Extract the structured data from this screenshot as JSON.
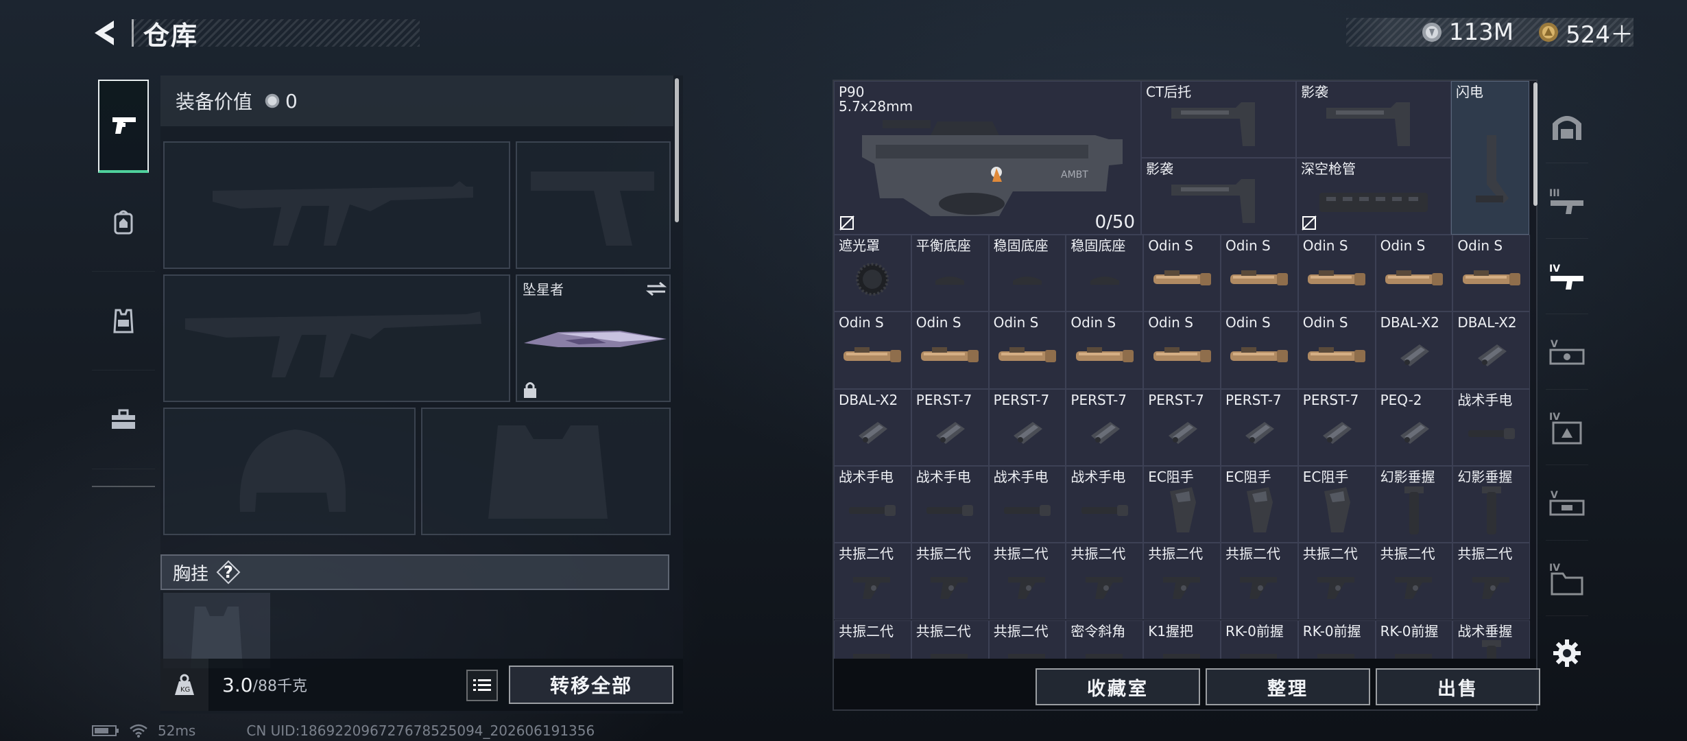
{
  "header": {
    "title": "仓库",
    "back_icon": "back-arrow-icon"
  },
  "currencies": [
    {
      "icon": "silver-coin-icon",
      "value": "113M",
      "color": "#c9ccd2"
    },
    {
      "icon": "gold-coin-icon",
      "value": "524＋",
      "color": "#d8b46a"
    }
  ],
  "left_rail": [
    {
      "icon": "pistol-icon",
      "active": true
    },
    {
      "icon": "backpack-icon",
      "active": false
    },
    {
      "icon": "vest-icon",
      "active": false
    },
    {
      "icon": "toolbox-icon",
      "active": false
    }
  ],
  "loadout": {
    "equip_value_label": "装备价值",
    "equip_value": "0",
    "melee_name": "坠星者",
    "chest_label": "胸挂",
    "help_glyph": "?",
    "weight_value": "3.0",
    "weight_capacity": "/88千克",
    "transfer_all_label": "转移全部"
  },
  "storage": {
    "p90": {
      "name": "P90",
      "caliber": "5.7x28mm",
      "ammo": "0/50"
    },
    "top_items": [
      {
        "name": "CT后托",
        "kind": "stock"
      },
      {
        "name": "影袭",
        "kind": "stock"
      },
      {
        "name": "闪电",
        "kind": "stock-v"
      },
      {
        "name": "影袭",
        "kind": "stock"
      },
      {
        "name": "深空枪管",
        "kind": "handguard"
      }
    ],
    "rows": [
      [
        {
          "name": "遮光罩",
          "kind": "hood"
        },
        {
          "name": "平衡底座",
          "kind": "mount"
        },
        {
          "name": "稳固底座",
          "kind": "mount"
        },
        {
          "name": "稳固底座",
          "kind": "mount"
        },
        {
          "name": "Odin S",
          "kind": "light"
        },
        {
          "name": "Odin S",
          "kind": "light"
        },
        {
          "name": "Odin S",
          "kind": "light"
        },
        {
          "name": "Odin S",
          "kind": "light"
        },
        {
          "name": "Odin S",
          "kind": "light"
        }
      ],
      [
        {
          "name": "Odin S",
          "kind": "light"
        },
        {
          "name": "Odin S",
          "kind": "light"
        },
        {
          "name": "Odin S",
          "kind": "light"
        },
        {
          "name": "Odin S",
          "kind": "light"
        },
        {
          "name": "Odin S",
          "kind": "light"
        },
        {
          "name": "Odin S",
          "kind": "light"
        },
        {
          "name": "Odin S",
          "kind": "light"
        },
        {
          "name": "DBAL-X2",
          "kind": "laser"
        },
        {
          "name": "DBAL-X2",
          "kind": "laser"
        }
      ],
      [
        {
          "name": "DBAL-X2",
          "kind": "laser"
        },
        {
          "name": "PERST-7",
          "kind": "laser"
        },
        {
          "name": "PERST-7",
          "kind": "laser"
        },
        {
          "name": "PERST-7",
          "kind": "laser"
        },
        {
          "name": "PERST-7",
          "kind": "laser"
        },
        {
          "name": "PERST-7",
          "kind": "laser"
        },
        {
          "name": "PERST-7",
          "kind": "laser"
        },
        {
          "name": "PEQ-2",
          "kind": "laser"
        },
        {
          "name": "战术手电",
          "kind": "flashlight"
        }
      ],
      [
        {
          "name": "战术手电",
          "kind": "flashlight"
        },
        {
          "name": "战术手电",
          "kind": "flashlight"
        },
        {
          "name": "战术手电",
          "kind": "flashlight"
        },
        {
          "name": "战术手电",
          "kind": "flashlight"
        },
        {
          "name": "EC阻手",
          "kind": "ecgrip"
        },
        {
          "name": "EC阻手",
          "kind": "ecgrip"
        },
        {
          "name": "EC阻手",
          "kind": "ecgrip"
        },
        {
          "name": "幻影垂握",
          "kind": "vgrip"
        },
        {
          "name": "幻影垂握",
          "kind": "vgrip"
        }
      ],
      [
        {
          "name": "共振二代",
          "kind": "agrip"
        },
        {
          "name": "共振二代",
          "kind": "agrip"
        },
        {
          "name": "共振二代",
          "kind": "agrip"
        },
        {
          "name": "共振二代",
          "kind": "agrip"
        },
        {
          "name": "共振二代",
          "kind": "agrip"
        },
        {
          "name": "共振二代",
          "kind": "agrip"
        },
        {
          "name": "共振二代",
          "kind": "agrip"
        },
        {
          "name": "共振二代",
          "kind": "agrip"
        },
        {
          "name": "共振二代",
          "kind": "agrip"
        }
      ],
      [
        {
          "name": "共振二代",
          "kind": "agrip"
        },
        {
          "name": "共振二代",
          "kind": "agrip"
        },
        {
          "name": "共振二代",
          "kind": "agrip"
        },
        {
          "name": "密令斜角",
          "kind": "agrip"
        },
        {
          "name": "K1握把",
          "kind": "agrip"
        },
        {
          "name": "RK-0前握",
          "kind": "agrip"
        },
        {
          "name": "RK-0前握",
          "kind": "agrip"
        },
        {
          "name": "RK-0前握",
          "kind": "agrip"
        },
        {
          "name": "战术垂握",
          "kind": "vgrip"
        }
      ]
    ],
    "buttons": {
      "collection": "收藏室",
      "organize": "整理",
      "sell": "出售"
    }
  },
  "right_rail": [
    {
      "icon": "helmet-shelf-icon",
      "label": ""
    },
    {
      "icon": "weapon-tier-3-icon",
      "label": "III"
    },
    {
      "icon": "weapon-tier-4-icon",
      "label": "IV",
      "active": true
    },
    {
      "icon": "attachment-tier-5-icon",
      "label": "V"
    },
    {
      "icon": "armor-tier-4-icon",
      "label": "IV"
    },
    {
      "icon": "attachment-tier-5b-icon",
      "label": "V"
    },
    {
      "icon": "folder-tier-4-icon",
      "label": "IV"
    },
    {
      "icon": "settings-gear-icon",
      "label": ""
    }
  ],
  "status_bar": {
    "battery_icon": "battery-icon",
    "wifi_icon": "wifi-icon",
    "ping": "52ms",
    "uid": "CN UID:186922096727678525094_202606191356"
  }
}
